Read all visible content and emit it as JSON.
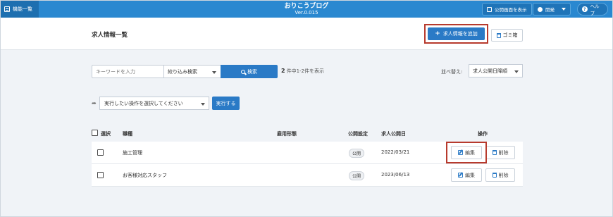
{
  "topbar": {
    "menu_label": "機能一覧",
    "app_title": "おりこうブログ",
    "version": "Ver.0.015",
    "public_view_label": "公開画面を表示",
    "dev_label": "開発",
    "help_label": "ヘルプ",
    "color": "#2a88d0"
  },
  "header": {
    "page_title": "求人情報一覧",
    "add_label": "求人情報を追加",
    "trash_label": "ゴミ箱"
  },
  "search": {
    "placeholder": "キーワードを入力",
    "filter_label": "絞り込み検索",
    "button_label": "検索",
    "count_number": "2",
    "count_text": "件中1-2件を表示",
    "sort_label": "並べ替え:",
    "sort_value": "求人公開日降順"
  },
  "bulk": {
    "select_placeholder": "実行したい操作を選択してください",
    "run_label": "実行する"
  },
  "table": {
    "headers": {
      "select": "選択",
      "job_type": "職種",
      "employment": "雇用形態",
      "public_setting": "公開設定",
      "publish_date": "求人公開日",
      "actions": "操作"
    },
    "rows": [
      {
        "job_type": "施工管理",
        "employment": "",
        "status": "公開",
        "date": "2022/03/21",
        "edit": "編集",
        "delete": "削除"
      },
      {
        "job_type": "お客様対応スタッフ",
        "employment": "",
        "status": "公開",
        "date": "2023/06/13",
        "edit": "編集",
        "delete": "削除"
      }
    ]
  },
  "colors": {
    "accent": "#2a7ac6",
    "highlight": "#b73a2d"
  }
}
